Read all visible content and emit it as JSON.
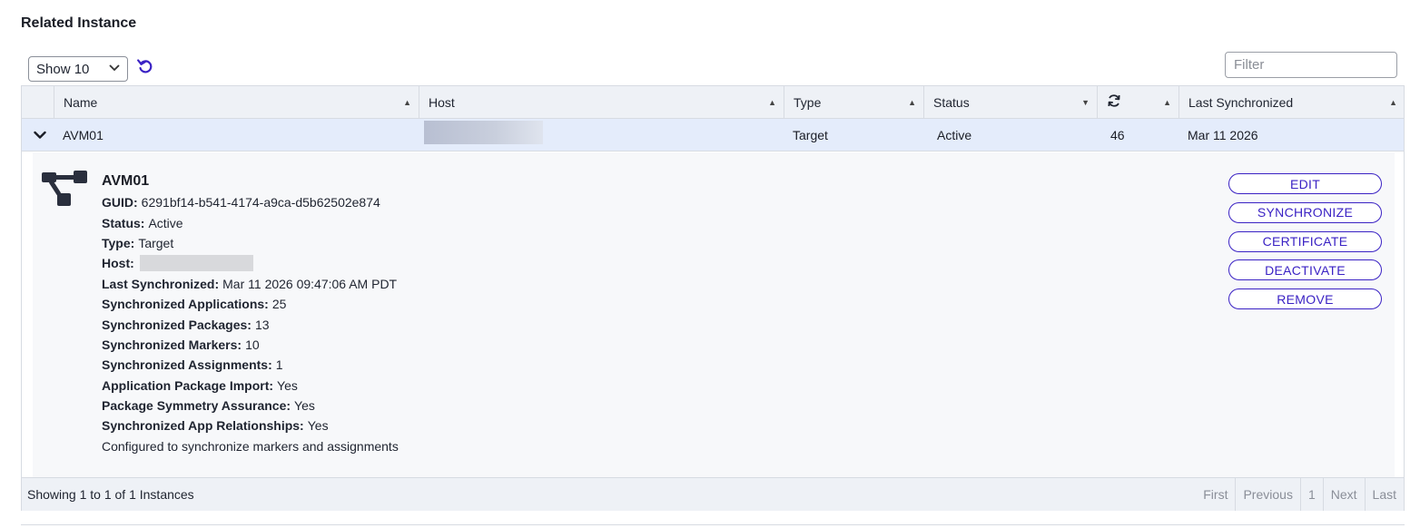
{
  "section": {
    "title": "Related Instance"
  },
  "controls": {
    "show_value": "Show 10",
    "filter_placeholder": "Filter"
  },
  "table": {
    "columns": [
      {
        "label": "Name",
        "sort": "asc"
      },
      {
        "label": "Host",
        "sort": "asc"
      },
      {
        "label": "Type",
        "sort": "asc"
      },
      {
        "label": "Status",
        "sort": "desc"
      },
      {
        "label": "",
        "icon": "sync-icon",
        "sort": "asc"
      },
      {
        "label": "Last Synchronized",
        "sort": "asc"
      }
    ],
    "row": {
      "name": "AVM01",
      "host": "",
      "type": "Target",
      "status": "Active",
      "sync_count": "46",
      "last_synchronized": "Mar 11 2026"
    }
  },
  "detail": {
    "title": "AVM01",
    "fields": [
      {
        "label": "GUID:",
        "value": "6291bf14-b541-4174-a9ca-d5b62502e874"
      },
      {
        "label": "Status:",
        "value": "Active"
      },
      {
        "label": "Type:",
        "value": "Target"
      },
      {
        "label": "Host:",
        "value": ""
      },
      {
        "label": "Last Synchronized:",
        "value": "Mar 11 2026 09:47:06 AM PDT"
      },
      {
        "label": "Synchronized Applications:",
        "value": "25"
      },
      {
        "label": "Synchronized Packages:",
        "value": "13"
      },
      {
        "label": "Synchronized Markers:",
        "value": "10"
      },
      {
        "label": "Synchronized Assignments:",
        "value": "1"
      },
      {
        "label": "Application Package Import:",
        "value": "Yes"
      },
      {
        "label": "Package Symmetry Assurance:",
        "value": "Yes"
      },
      {
        "label": "Synchronized App Relationships:",
        "value": "Yes"
      }
    ],
    "note": "Configured to synchronize markers and assignments",
    "actions": {
      "edit": "EDIT",
      "synchronize": "SYNCHRONIZE",
      "certificate": "CERTIFICATE",
      "deactivate": "DEACTIVATE",
      "remove": "REMOVE"
    }
  },
  "footer": {
    "info": "Showing 1 to 1 of 1 Instances",
    "pager": {
      "first": "First",
      "previous": "Previous",
      "page": "1",
      "next": "Next",
      "last": "Last"
    }
  },
  "colors": {
    "accent": "#3a22c4",
    "header_bg": "#eef1f6",
    "selected_row_bg": "#e4ecfb"
  }
}
